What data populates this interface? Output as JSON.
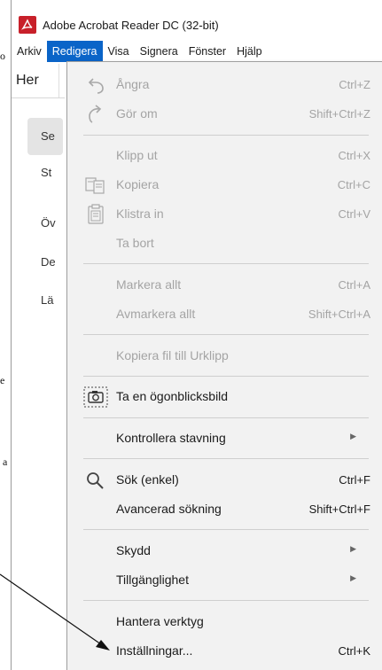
{
  "window": {
    "title": "Adobe Acrobat Reader DC (32-bit)"
  },
  "menubar": {
    "items": [
      {
        "label": "Arkiv"
      },
      {
        "label": "Redigera",
        "active": true
      },
      {
        "label": "Visa"
      },
      {
        "label": "Signera"
      },
      {
        "label": "Fönster"
      },
      {
        "label": "Hjälp"
      }
    ]
  },
  "background": {
    "tab": "Her",
    "side_items": [
      "Se",
      "St",
      "Öv",
      "De",
      "Lä"
    ]
  },
  "edit_menu": {
    "items": [
      {
        "label": "Ångra",
        "shortcut": "Ctrl+Z",
        "icon": "undo-icon",
        "disabled": true
      },
      {
        "label": "Gör om",
        "shortcut": "Shift+Ctrl+Z",
        "icon": "redo-icon",
        "disabled": true
      },
      {
        "label": "Klipp ut",
        "shortcut": "Ctrl+X",
        "disabled": true
      },
      {
        "label": "Kopiera",
        "shortcut": "Ctrl+C",
        "icon": "copy-icon",
        "disabled": true
      },
      {
        "label": "Klistra in",
        "shortcut": "Ctrl+V",
        "icon": "paste-icon",
        "disabled": true
      },
      {
        "label": "Ta bort",
        "disabled": true
      },
      {
        "label": "Markera allt",
        "shortcut": "Ctrl+A",
        "disabled": true
      },
      {
        "label": "Avmarkera allt",
        "shortcut": "Shift+Ctrl+A",
        "disabled": true
      },
      {
        "label": "Kopiera fil till Urklipp",
        "disabled": true
      },
      {
        "label": "Ta en ögonblicksbild",
        "icon": "camera-icon",
        "disabled": false
      },
      {
        "label": "Kontrollera stavning",
        "submenu": true,
        "disabled": false
      },
      {
        "label": "Sök (enkel)",
        "shortcut": "Ctrl+F",
        "icon": "search-icon",
        "disabled": false
      },
      {
        "label": "Avancerad sökning",
        "shortcut": "Shift+Ctrl+F",
        "disabled": false
      },
      {
        "label": "Skydd",
        "submenu": true,
        "disabled": false
      },
      {
        "label": "Tillgänglighet",
        "submenu": true,
        "disabled": false
      },
      {
        "label": "Hantera verktyg",
        "disabled": false
      },
      {
        "label": "Inställningar...",
        "shortcut": "Ctrl+K",
        "disabled": false
      }
    ]
  },
  "colors": {
    "accent": "#0a64c8",
    "menu_bg": "#f2f2f2",
    "disabled_text": "#a4a4a4",
    "brand_red": "#c8202a"
  }
}
